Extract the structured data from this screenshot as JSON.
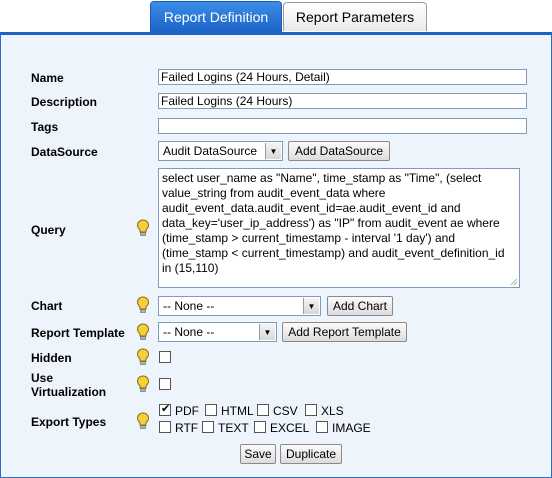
{
  "tabs": {
    "definition": "Report Definition",
    "parameters": "Report Parameters"
  },
  "form": {
    "name": {
      "label": "Name",
      "value": "Failed Logins (24 Hours, Detail)"
    },
    "description": {
      "label": "Description",
      "value": "Failed Logins (24 Hours)"
    },
    "tags": {
      "label": "Tags",
      "value": ""
    },
    "datasource": {
      "label": "DataSource",
      "selected": "Audit DataSource",
      "add_button": "Add DataSource"
    },
    "query": {
      "label": "Query",
      "value": "select user_name as \"Name\", time_stamp as \"Time\", (select value_string from audit_event_data where audit_event_data.audit_event_id=ae.audit_event_id and data_key='user_ip_address') as \"IP\" from audit_event ae where (time_stamp > current_timestamp - interval '1 day') and (time_stamp < current_timestamp) and audit_event_definition_id in (15,110)"
    },
    "chart": {
      "label": "Chart",
      "selected": "-- None --",
      "add_button": "Add Chart"
    },
    "report_template": {
      "label": "Report Template",
      "selected": "-- None --",
      "add_button": "Add Report Template"
    },
    "hidden": {
      "label": "Hidden",
      "checked": false
    },
    "use_virtualization": {
      "label_line1": "Use",
      "label_line2": "Virtualization",
      "checked": false
    },
    "export_types": {
      "label": "Export Types",
      "options": [
        {
          "label": "PDF",
          "checked": true
        },
        {
          "label": "HTML",
          "checked": false
        },
        {
          "label": "CSV",
          "checked": false
        },
        {
          "label": "XLS",
          "checked": false
        },
        {
          "label": "RTF",
          "checked": false
        },
        {
          "label": "TEXT",
          "checked": false
        },
        {
          "label": "EXCEL",
          "checked": false
        },
        {
          "label": "IMAGE",
          "checked": false
        }
      ]
    }
  },
  "actions": {
    "save": "Save",
    "duplicate": "Duplicate"
  },
  "colors": {
    "tab_active": "#1c63c6",
    "panel_bg": "#eef4fb",
    "bulb": "#f0c419"
  },
  "icons": {
    "help": "lightbulb-icon",
    "dropdown": "chevron-down-icon",
    "check": "check-icon"
  }
}
